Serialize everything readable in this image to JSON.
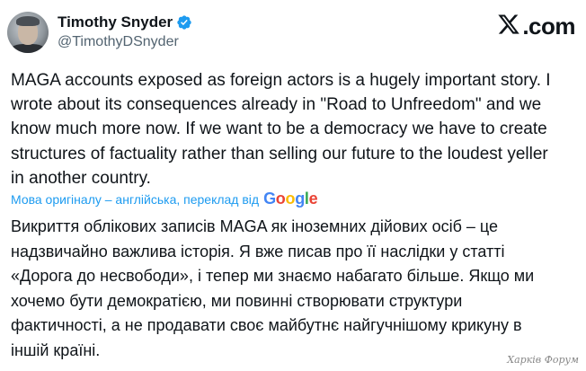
{
  "author": {
    "display_name": "Timothy Snyder",
    "handle": "@TimothyDSnyder",
    "verified": true
  },
  "brand": {
    "icon": "x-logo-icon",
    "label": ".com"
  },
  "tweet": {
    "text": "MAGA accounts exposed as foreign actors is a hugely important story. I\nwrote about its consequences already in \"Road to Unfreedom\" and we\nknow much more now. If we want to be a democracy we have to create\nstructures of factuality rather than selling our future to the loudest yeller\nin another country."
  },
  "translation": {
    "note": "Мова оригіналу – англійська, переклад від",
    "provider": "Google",
    "provider_colors": [
      "#4285F4",
      "#EA4335",
      "#FBBC05",
      "#4285F4",
      "#34A853",
      "#EA4335"
    ],
    "text": "Викриття облікових записів MAGA як іноземних дійових осіб – це\nнадзвичайно важлива історія. Я вже писав про її наслідки у статті\n«Дорога до несвободи», і тепер ми знаємо набагато більше. Якщо ми\nхочемо бути демократією, ми повинні створювати структури\nфактичності, а не продавати своє майбутнє найгучнішому крикуну в\nіншій країні."
  },
  "watermark": "Харків Форум",
  "colors": {
    "link": "#1d9bf0",
    "secondary_text": "#536471",
    "primary_text": "#0f1419"
  }
}
